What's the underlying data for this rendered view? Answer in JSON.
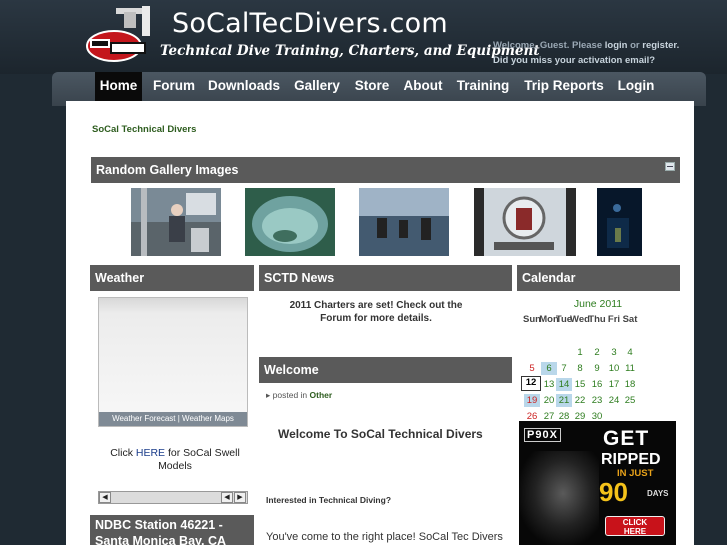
{
  "header": {
    "site_title": "SoCalTecDivers.com",
    "tagline": "Technical Dive Training, Charters, and Equipment",
    "welcome_guest": "Welcome, Guest. Please",
    "login": "login",
    "or": "or",
    "register": "register.",
    "activation": "Did you miss your activation email?"
  },
  "nav": [
    "Home",
    "Forum",
    "Downloads",
    "Gallery",
    "Store",
    "About",
    "Training",
    "Trip Reports",
    "Login"
  ],
  "breadcrumb": "SoCal Technical Divers",
  "gallery": {
    "title": "Random Gallery Images"
  },
  "weather": {
    "title": "Weather",
    "forecast_links": "Weather Forecast | Weather Maps",
    "swell_pre": "Click",
    "swell_link": "HERE",
    "swell_post": "for SoCal Swell",
    "swell_line2": "Models"
  },
  "ndbc": {
    "title_line1": "NDBC Station 46221 -",
    "title_line2": "Santa Monica Bay, CA"
  },
  "news": {
    "title": "SCTD News",
    "text_line1": "2011 Charters are set!  Check out the",
    "text_line2": "Forum for more details."
  },
  "welcome_block": {
    "title": "Welcome",
    "posted_in": "posted in",
    "category": "Other",
    "heading": "Welcome To SoCal Technical Divers",
    "question": "Interested in Technical Diving?",
    "intro": "You've come to the right place! SoCal Tec Divers"
  },
  "calendar": {
    "title": "Calendar",
    "month": "June 2011",
    "days": [
      "Sun",
      "Mon",
      "Tue",
      "Wed",
      "Thu",
      "Fri",
      "Sat"
    ],
    "weeks": [
      [
        "",
        "",
        "",
        "1",
        "2",
        "3",
        "4"
      ],
      [
        "5",
        "6",
        "7",
        "8",
        "9",
        "10",
        "11"
      ],
      [
        "12",
        "13",
        "14",
        "15",
        "16",
        "17",
        "18"
      ],
      [
        "19",
        "20",
        "21",
        "22",
        "23",
        "24",
        "25"
      ],
      [
        "26",
        "27",
        "28",
        "29",
        "30",
        "",
        ""
      ]
    ]
  },
  "ad": {
    "brand": "P90X",
    "get": "GET",
    "ripped": "RIPPED",
    "in_just": "IN JUST",
    "ninety": "90",
    "days": "DAYS",
    "cta_line1": "CLICK",
    "cta_line2": "HERE"
  },
  "colors": {
    "page_bg": "#1f2a33",
    "nav_bg": "#444f5a",
    "block_header": "#5a5a5a",
    "link_green": "#2e5d1f",
    "calendar_green": "#2e7d1f",
    "sunday_red": "#cc2222",
    "highlight_blue": "#b9d7ea"
  }
}
